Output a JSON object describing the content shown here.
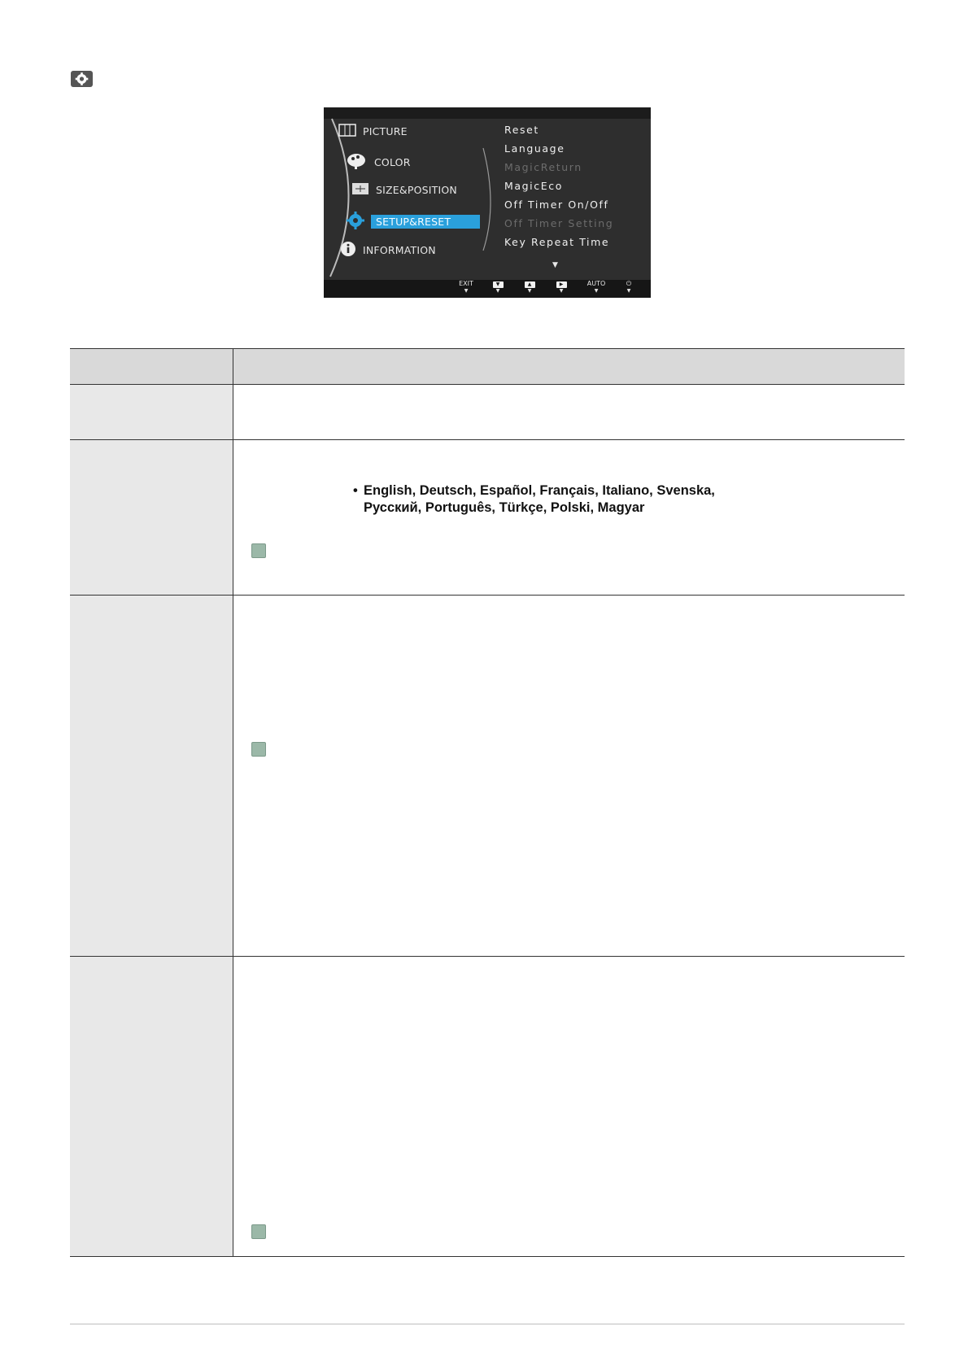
{
  "page_icon": "setup-gear-icon",
  "osd": {
    "left_menu": [
      {
        "label": "PICTURE",
        "icon": "picture-icon"
      },
      {
        "label": "COLOR",
        "icon": "color-palette-icon"
      },
      {
        "label": "SIZE&POSITION",
        "icon": "size-position-icon"
      },
      {
        "label": "SETUP&RESET",
        "icon": "setup-gear-icon",
        "selected": true
      },
      {
        "label": "INFORMATION",
        "icon": "info-icon"
      }
    ],
    "right_menu": [
      {
        "label": "Reset",
        "enabled": true
      },
      {
        "label": "Language",
        "enabled": true
      },
      {
        "label": "MagicReturn",
        "enabled": false
      },
      {
        "label": "MagicEco",
        "enabled": true
      },
      {
        "label": "Off Timer On/Off",
        "enabled": true
      },
      {
        "label": "Off Timer Setting",
        "enabled": false
      },
      {
        "label": "Key Repeat Time",
        "enabled": true
      }
    ],
    "more_indicator": "▼",
    "buttons": [
      {
        "label": "EXIT",
        "icon": "exit-button"
      },
      {
        "label": "▼",
        "icon": "down-button"
      },
      {
        "label": "▲",
        "icon": "up-button"
      },
      {
        "label": "▶",
        "icon": "enter-button"
      },
      {
        "label": "AUTO",
        "icon": "auto-button"
      },
      {
        "label": "⏻",
        "icon": "power-icon"
      }
    ],
    "colors": {
      "selected": "#2aa0dc",
      "background": "#2e2e2e"
    }
  },
  "table": {
    "languages_line1": "English, Deutsch, Español, Français, Italiano, Svenska,",
    "languages_line2": "Русский, Português, Türkçe, Polski, Magyar",
    "bullet": "•"
  }
}
